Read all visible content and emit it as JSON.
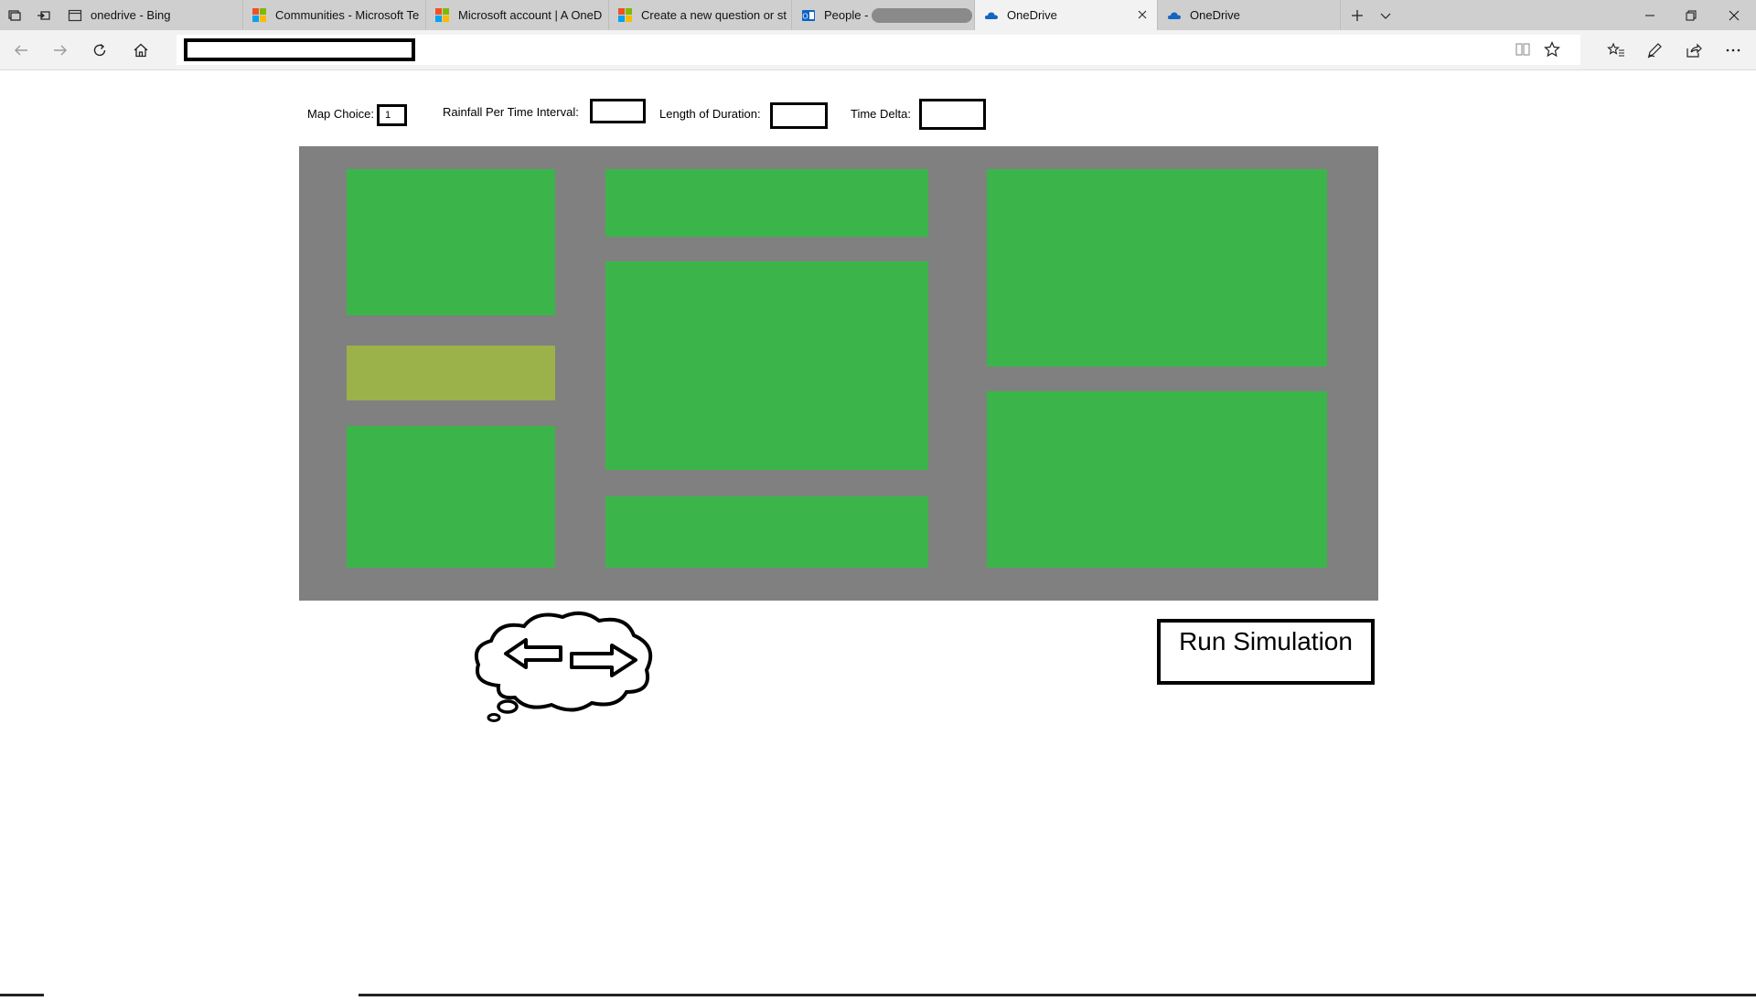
{
  "browser": {
    "tabs": [
      {
        "label": "onedrive - Bing",
        "icon": "page-icon"
      },
      {
        "label": "Communities - Microsoft Te",
        "icon": "microsoft-logo-icon"
      },
      {
        "label": "Microsoft account | A OneD",
        "icon": "microsoft-logo-icon"
      },
      {
        "label": "Create a new question or st",
        "icon": "microsoft-logo-icon"
      },
      {
        "label": "People -",
        "icon": "outlook-icon"
      },
      {
        "label": "OneDrive",
        "icon": "onedrive-cloud-icon",
        "active": true
      },
      {
        "label": "OneDrive",
        "icon": "onedrive-cloud-icon"
      }
    ],
    "address_value": ""
  },
  "form": {
    "map_choice_label": "Map Choice:",
    "map_choice_value": "1",
    "rainfall_label": "Rainfall Per Time Interval:",
    "rainfall_value": "",
    "duration_label": "Length of Duration:",
    "duration_value": "",
    "time_delta_label": "Time Delta:",
    "time_delta_value": ""
  },
  "map": {
    "road_color": "#808080",
    "grass_color": "#3bb54a",
    "highlight_color": "#9bb24a"
  },
  "run_button_label": "Run Simulation",
  "icons": {
    "map_nav": "cloud-with-left-right-arrows-icon"
  }
}
